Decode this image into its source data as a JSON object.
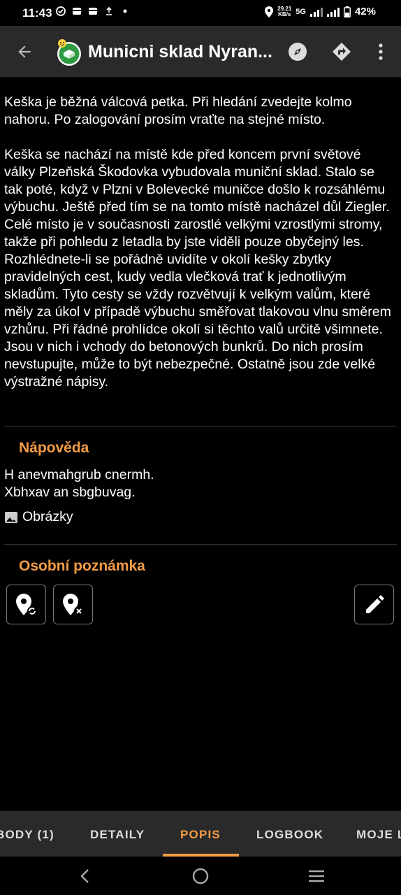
{
  "status_bar": {
    "time": "11:43",
    "net_speed_value": "29.21",
    "net_speed_unit": "KB/s",
    "network": "5G",
    "battery": "42%"
  },
  "toolbar": {
    "title": "Municni sklad Nyran...",
    "back_icon": "arrow-left-icon",
    "cache_icon": "traditional-cache-icon",
    "compass_icon": "compass-icon",
    "navigate_icon": "navigate-icon",
    "more_icon": "more-vert-icon"
  },
  "description": {
    "paragraph1": "Keška je běžná válcová petka. Při hledání zvedejte kolmo nahoru. Po zalogování prosím vraťte na stejné místo.",
    "paragraph2": "Keška se nachází na místě kde před koncem první světové války Plzeňská Škodovka vybudovala muniční sklad. Stalo se tak poté, když v Plzni v Bolevecké muničce došlo k rozsáhlému výbuchu. Ještě před tím se na tomto místě nacházel důl Ziegler. Celé místo je v současnosti zarostlé velkými vzrostlými stromy, takže při pohledu z letadla by jste viděli pouze obyčejný les. Rozhlédnete-li se pořádně uvidíte v okolí kešky zbytky pravidelných cest, kudy vedla vlečková trať k jednotlivým skladům. Tyto cesty se vždy rozvětvují k velkým valům, které měly za úkol v případě výbuchu směřovat tlakovou vlnu směrem vzhůru. Při řádné prohlídce okolí si těchto valů určitě všimnete. Jsou v nich i vchody do betonových bunkrů. Do nich prosím nevstupujte, může to být nebezpečné. Ostatně jsou zde velké výstražné nápisy."
  },
  "hint": {
    "title": "Nápověda",
    "text": "H anevmahgrub cnermh.\nXbhxav an sbgbuvag."
  },
  "pictures": {
    "label": "Obrázky",
    "icon": "image-icon"
  },
  "personal_note": {
    "title": "Osobní poznámka",
    "buttons": [
      "location-sync-icon",
      "location-remove-icon",
      "edit-pencil-icon"
    ]
  },
  "tabs": {
    "items": [
      "BODY (1)",
      "DETAILY",
      "POPIS",
      "LOGBOOK",
      "MOJE LO"
    ],
    "active": "POPIS"
  },
  "colors": {
    "accent": "#f39c45",
    "toolbar_bg": "#2a2a2a",
    "background": "#000000"
  }
}
